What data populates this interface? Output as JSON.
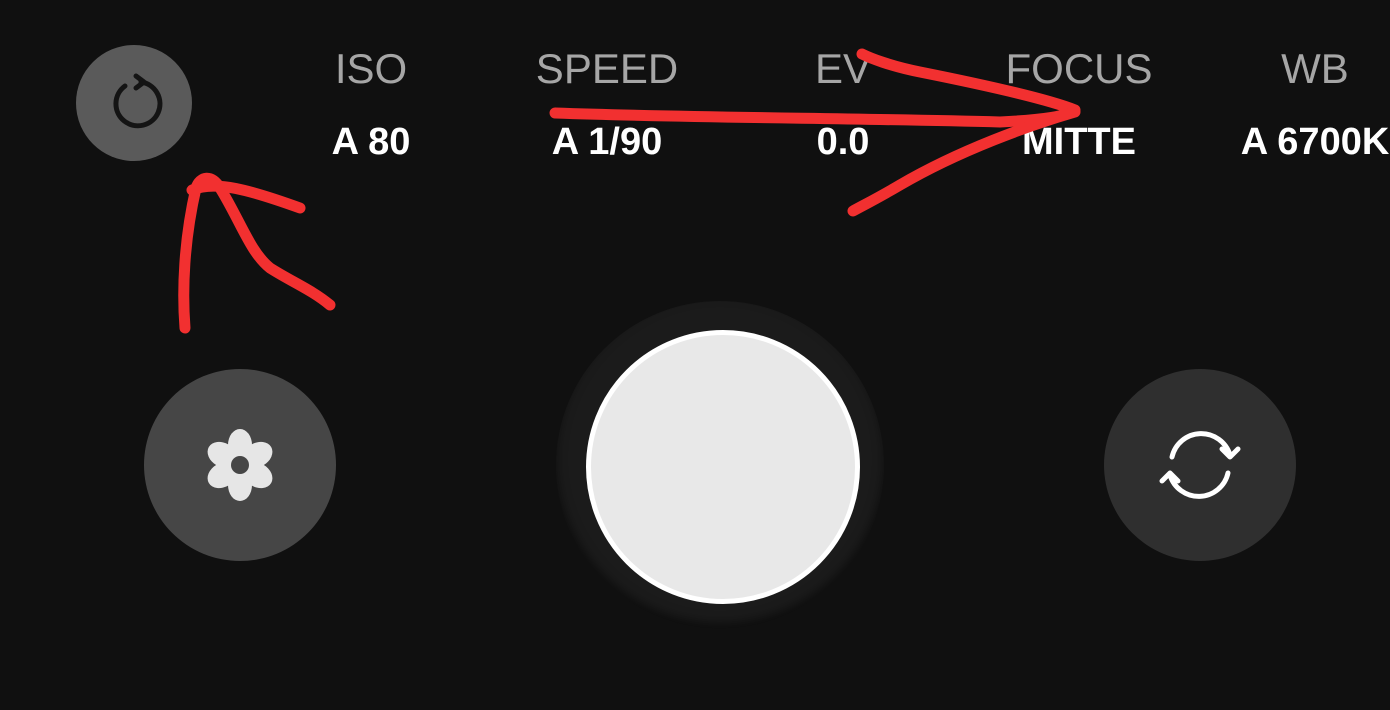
{
  "parameters": [
    {
      "label": "ISO",
      "value": "A 80"
    },
    {
      "label": "SPEED",
      "value": "A 1/90"
    },
    {
      "label": "EV",
      "value": "0.0"
    },
    {
      "label": "FOCUS",
      "value": "MITTE"
    },
    {
      "label": "WB",
      "value": "A 6700K"
    }
  ],
  "icons": {
    "reset": "reset-icon",
    "mode": "flower-icon",
    "shutter": "shutter-icon",
    "switch_camera": "switch-camera-icon"
  },
  "colors": {
    "background": "#101010",
    "label": "#a6a6a6",
    "value": "#ffffff",
    "annotation": "#f23030"
  }
}
